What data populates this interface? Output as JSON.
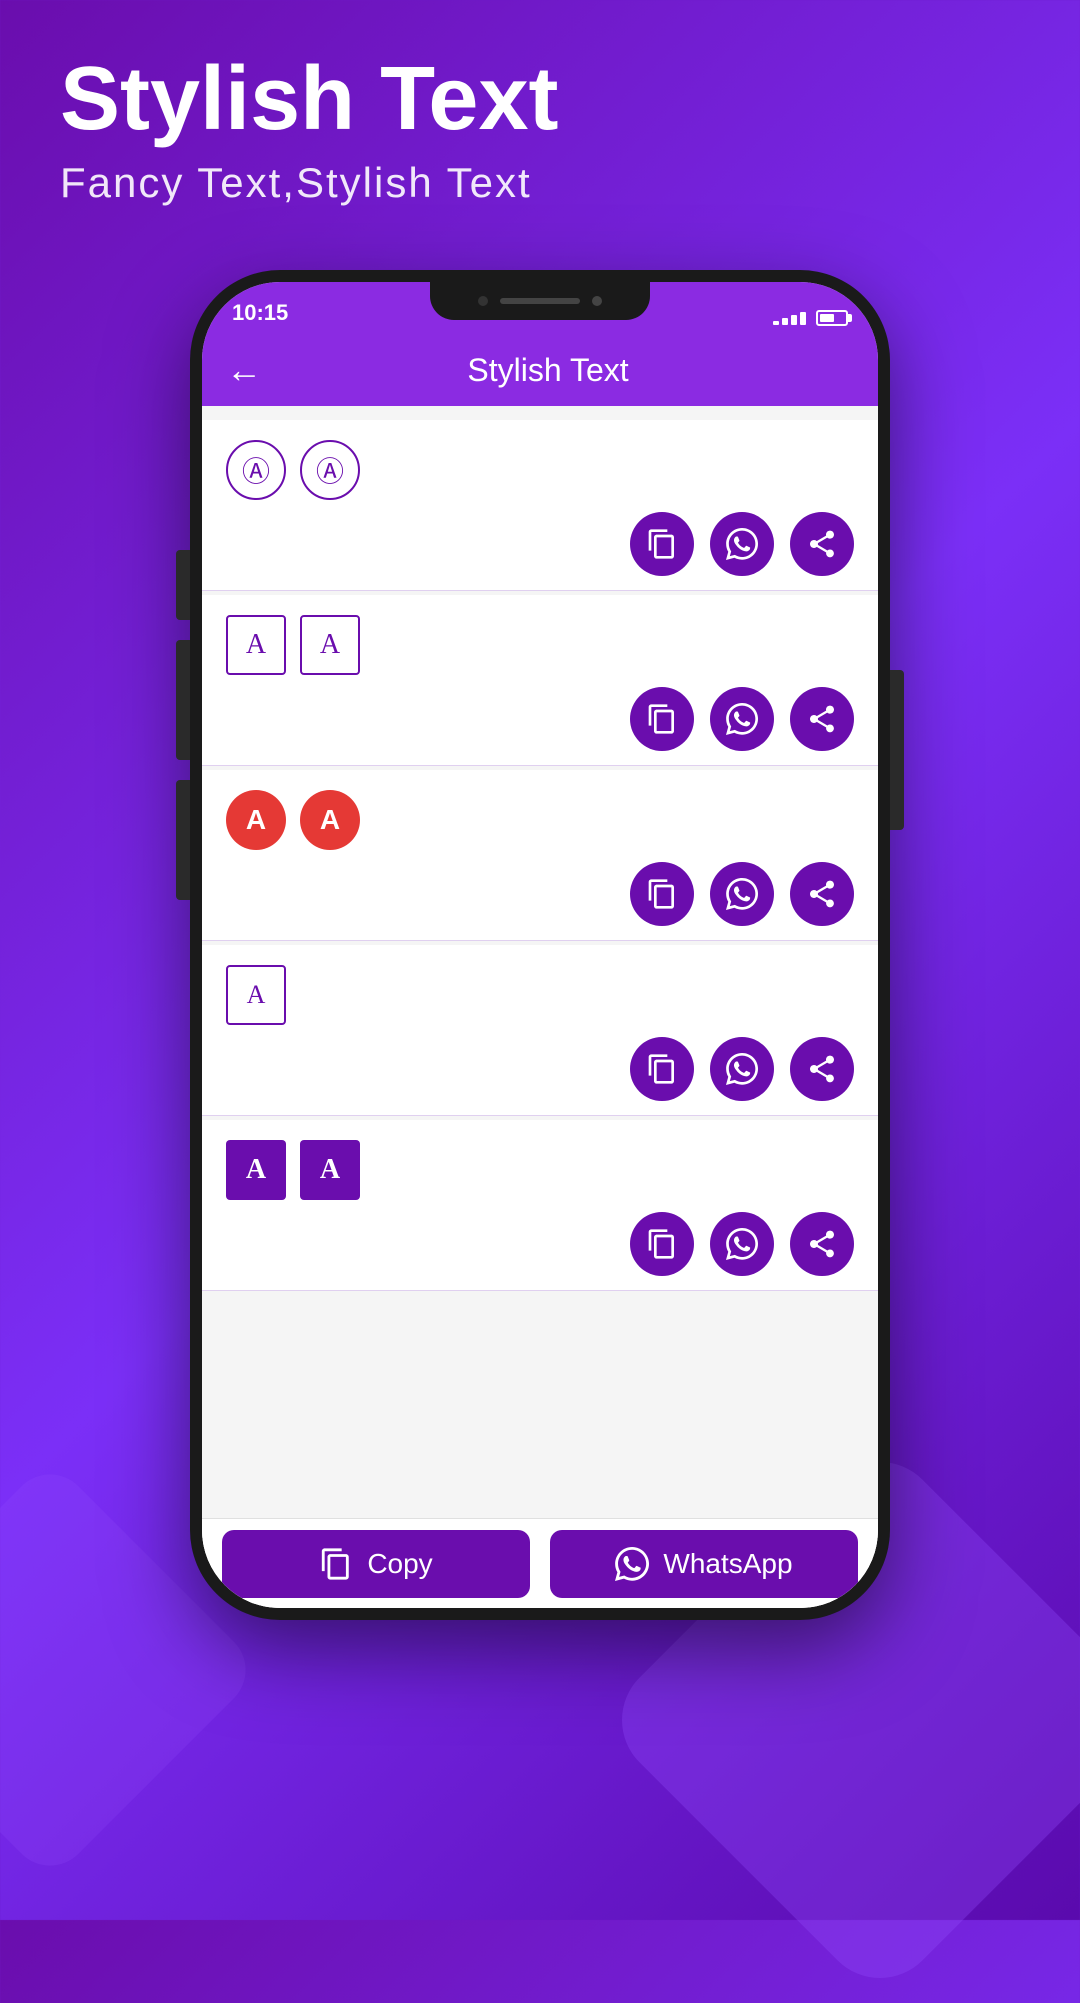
{
  "background": {
    "gradient_start": "#6a0dad",
    "gradient_end": "#7b2ff7"
  },
  "header": {
    "title": "Stylish Text",
    "subtitle": "Fancy Text,Stylish Text"
  },
  "phone": {
    "status_bar": {
      "time": "10:15",
      "signal_bars": [
        4,
        7,
        10,
        13
      ],
      "battery_percent": 60
    },
    "app_bar": {
      "title": "Stylish Text",
      "back_label": "←"
    },
    "style_rows": [
      {
        "id": "row1",
        "letters": [
          "Ⓐ",
          "Ⓐ"
        ],
        "style": "circle-outline"
      },
      {
        "id": "row2",
        "letters": [
          "🄰",
          "🄰"
        ],
        "style": "square-outline"
      },
      {
        "id": "row3",
        "letters": [
          "A",
          "A"
        ],
        "style": "circle-red"
      },
      {
        "id": "row4",
        "letters": [
          "A"
        ],
        "style": "square-single"
      },
      {
        "id": "row5",
        "letters": [
          "A",
          "A"
        ],
        "style": "square-purple"
      }
    ],
    "action_buttons": {
      "copy_tooltip": "Copy",
      "whatsapp_tooltip": "WhatsApp",
      "share_tooltip": "Share"
    },
    "bottom_bar": {
      "copy_label": "Copy",
      "whatsapp_label": "WhatsApp"
    }
  }
}
